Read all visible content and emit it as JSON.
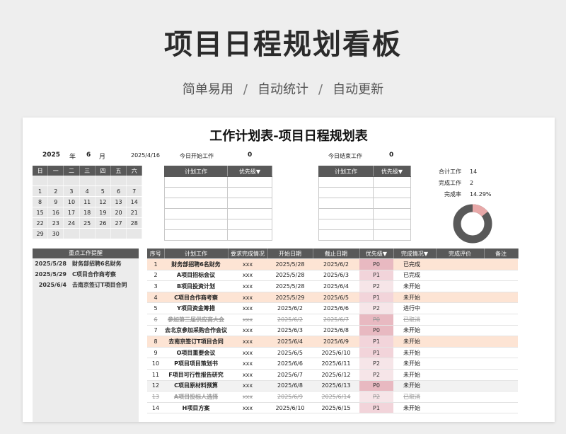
{
  "hero": {
    "title": "项目日程规划看板",
    "subtitle_parts": [
      "简单易用",
      "自动统计",
      "自动更新"
    ],
    "separator": "/"
  },
  "sheet": {
    "title": "工作计划表-项目日程规划表",
    "year": "2025",
    "year_label": "年",
    "month": "6",
    "month_label": "月",
    "today_date": "2025/4/16",
    "today_start_label": "今日开始工作",
    "today_start_count": "0",
    "today_end_label": "今日结束工作",
    "today_end_count": "0"
  },
  "calendar": {
    "weekdays": [
      "日",
      "一",
      "二",
      "三",
      "四",
      "五",
      "六"
    ],
    "weeks": [
      [
        "",
        "",
        "",
        "",
        "",
        "",
        ""
      ],
      [
        "1",
        "2",
        "3",
        "4",
        "5",
        "6",
        "7"
      ],
      [
        "8",
        "9",
        "10",
        "11",
        "12",
        "13",
        "14"
      ],
      [
        "15",
        "16",
        "17",
        "18",
        "19",
        "20",
        "21"
      ],
      [
        "22",
        "23",
        "24",
        "25",
        "26",
        "27",
        "28"
      ],
      [
        "29",
        "30",
        "",
        "",
        "",
        "",
        ""
      ]
    ]
  },
  "start_table": {
    "headers": [
      "计划工作",
      "优先级▼"
    ]
  },
  "end_table": {
    "headers": [
      "计划工作",
      "优先级▼"
    ]
  },
  "stats": {
    "total_label": "合计工作",
    "total": "14",
    "done_label": "完成工作",
    "done": "2",
    "rate_label": "完成率",
    "rate": "14.29%",
    "rate_value": 0.1429,
    "colors": {
      "done": "#e8a8a8",
      "remaining": "#595959"
    }
  },
  "reminder": {
    "title": "重点工作提醒",
    "items": [
      {
        "date": "2025/5/28",
        "task": "财务部招聘6名财务"
      },
      {
        "date": "2025/5/29",
        "task": "C项目合作商考察"
      },
      {
        "date": "2025/6/4",
        "task": "去南京签订T项目合同"
      }
    ]
  },
  "main_table": {
    "headers": [
      "序号",
      "计划工作",
      "要求完成情况",
      "开始日期",
      "截止日期",
      "优先级▼",
      "完成情况▼",
      "完成评价",
      "备注"
    ],
    "rows": [
      {
        "no": "1",
        "task": "财务部招聘6名财务",
        "req": "xxx",
        "start": "2025/5/28",
        "end": "2025/6/2",
        "priority": "P0",
        "status": "已完成",
        "style": "hl"
      },
      {
        "no": "2",
        "task": "A项目招标会议",
        "req": "xxx",
        "start": "2025/5/28",
        "end": "2025/6/3",
        "priority": "P1",
        "status": "已完成",
        "style": ""
      },
      {
        "no": "3",
        "task": "B项目投资计划",
        "req": "xxx",
        "start": "2025/5/28",
        "end": "2025/6/4",
        "priority": "P2",
        "status": "未开始",
        "style": ""
      },
      {
        "no": "4",
        "task": "C项目合作商考察",
        "req": "xxx",
        "start": "2025/5/29",
        "end": "2025/6/5",
        "priority": "P1",
        "status": "未开始",
        "style": "hl"
      },
      {
        "no": "5",
        "task": "Y项目资金筹措",
        "req": "xxx",
        "start": "2025/6/2",
        "end": "2025/6/6",
        "priority": "P2",
        "status": "进行中",
        "style": ""
      },
      {
        "no": "6",
        "task": "参加第三届供应商大会",
        "req": "xxx",
        "start": "2025/6/2",
        "end": "2025/6/7",
        "priority": "P0",
        "status": "已取消",
        "style": "done"
      },
      {
        "no": "7",
        "task": "去北京参加采购合作会议",
        "req": "xxx",
        "start": "2025/6/3",
        "end": "2025/6/8",
        "priority": "P0",
        "status": "未开始",
        "style": ""
      },
      {
        "no": "8",
        "task": "去南京签订T项目合同",
        "req": "xxx",
        "start": "2025/6/4",
        "end": "2025/6/9",
        "priority": "P1",
        "status": "未开始",
        "style": "hl"
      },
      {
        "no": "9",
        "task": "O项目重要会议",
        "req": "xxx",
        "start": "2025/6/5",
        "end": "2025/6/10",
        "priority": "P1",
        "status": "未开始",
        "style": ""
      },
      {
        "no": "10",
        "task": "P项目项目策划书",
        "req": "xxx",
        "start": "2025/6/6",
        "end": "2025/6/11",
        "priority": "P2",
        "status": "未开始",
        "style": ""
      },
      {
        "no": "11",
        "task": "F项目可行性报告研究",
        "req": "xxx",
        "start": "2025/6/7",
        "end": "2025/6/12",
        "priority": "P2",
        "status": "未开始",
        "style": ""
      },
      {
        "no": "12",
        "task": "C项目原材料预算",
        "req": "xxx",
        "start": "2025/6/8",
        "end": "2025/6/13",
        "priority": "P0",
        "status": "未开始",
        "style": "gy"
      },
      {
        "no": "13",
        "task": "A项目投标人选择",
        "req": "xxx",
        "start": "2025/6/9",
        "end": "2025/6/14",
        "priority": "P2",
        "status": "已取消",
        "style": "done"
      },
      {
        "no": "14",
        "task": "H项目方案",
        "req": "xxx",
        "start": "2025/6/10",
        "end": "2025/6/15",
        "priority": "P1",
        "status": "未开始",
        "style": ""
      }
    ]
  }
}
